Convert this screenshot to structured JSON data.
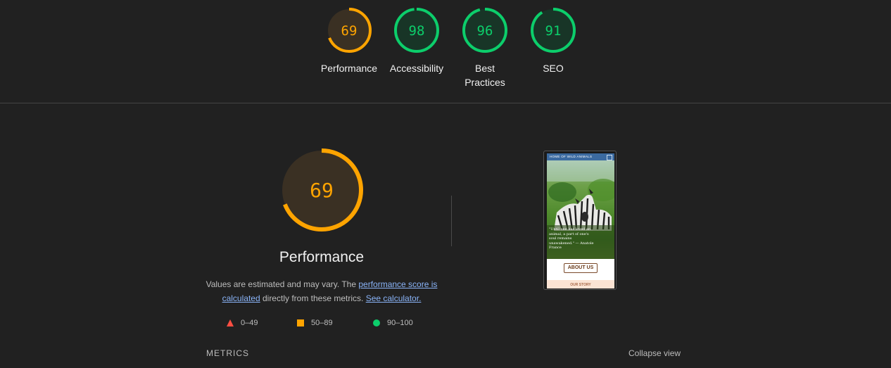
{
  "gauges": [
    {
      "score": "69",
      "label": "Performance",
      "fraction": 0.69,
      "color": "#ffa400",
      "bg": "#3a3023"
    },
    {
      "score": "98",
      "label": "Accessibility",
      "fraction": 0.98,
      "color": "#0cce6b",
      "bg": "#183527"
    },
    {
      "score": "96",
      "label": "Best Practices",
      "fraction": 0.96,
      "color": "#0cce6b",
      "bg": "#183527"
    },
    {
      "score": "91",
      "label": "SEO",
      "fraction": 0.91,
      "color": "#0cce6b",
      "bg": "#183527"
    }
  ],
  "performance": {
    "score": "69",
    "fraction": 0.69,
    "title": "Performance",
    "desc_prefix": "Values are estimated and may vary. The ",
    "score_link": "performance score is calculated",
    "desc_middle": " directly from these metrics. ",
    "calc_link": "See calculator."
  },
  "legend": [
    {
      "range": "0–49",
      "shape": "triangle",
      "color": "#ff4e42"
    },
    {
      "range": "50–89",
      "shape": "square",
      "color": "#ffa400"
    },
    {
      "range": "90–100",
      "shape": "circle",
      "color": "#0cce6b"
    }
  ],
  "screenshot": {
    "header": "HOME OF WILD ANIMALS",
    "quote": "\"Until one has loved an animal, a part of one's soul remains unawakened.\" — Anatole France",
    "button": "ABOUT US",
    "section": "OUR STORY"
  },
  "footer": {
    "metrics": "METRICS",
    "collapse": "Collapse view"
  }
}
